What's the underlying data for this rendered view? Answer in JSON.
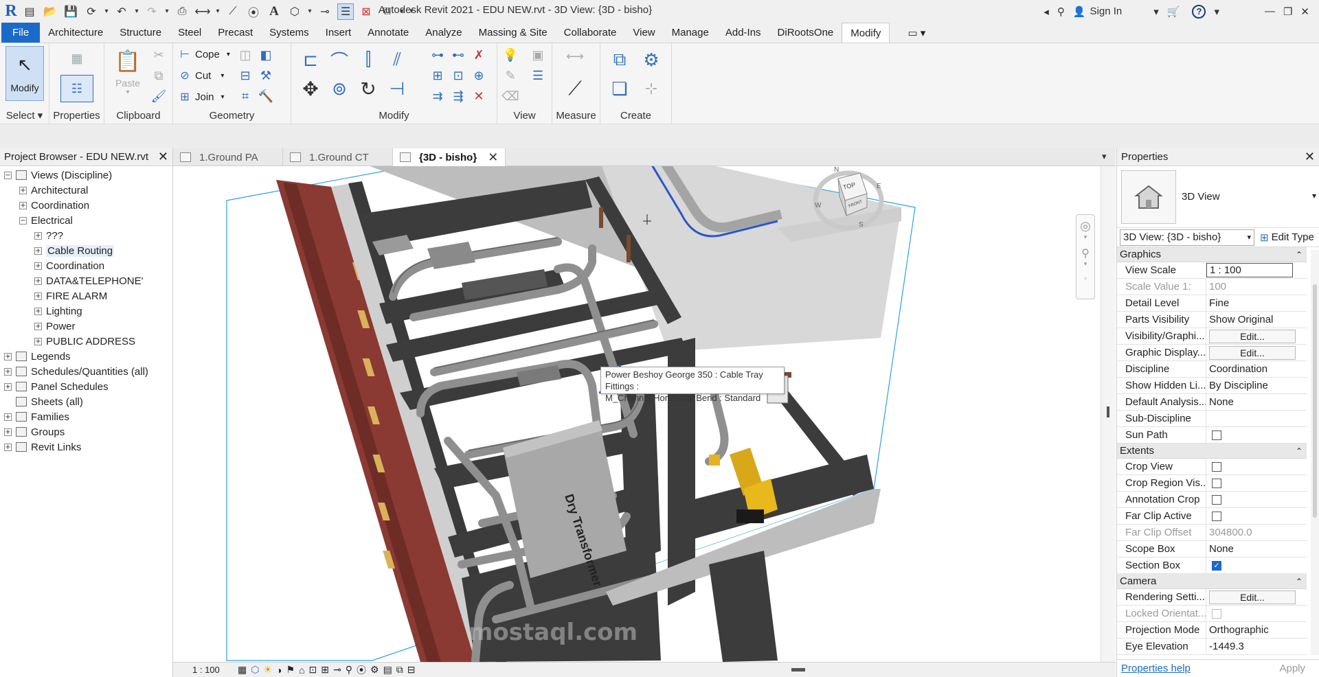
{
  "window": {
    "title": "Autodesk Revit 2021 - EDU NEW.rvt - 3D View: {3D - bisho}",
    "sign_in": "Sign In"
  },
  "menu": {
    "tabs": [
      "File",
      "Architecture",
      "Structure",
      "Steel",
      "Precast",
      "Systems",
      "Insert",
      "Annotate",
      "Analyze",
      "Massing & Site",
      "Collaborate",
      "View",
      "Manage",
      "Add-Ins",
      "DiRootsOne",
      "Modify"
    ],
    "active": "Modify"
  },
  "ribbon": {
    "modify_label": "Modify",
    "select_label": "Select",
    "properties_label": "Properties",
    "paste_label": "Paste",
    "clipboard_label": "Clipboard",
    "cope_label": "Cope",
    "cut_label": "Cut",
    "join_label": "Join",
    "geometry_label": "Geometry",
    "modify_panel_label": "Modify",
    "view_label": "View",
    "measure_label": "Measure",
    "create_label": "Create"
  },
  "browser": {
    "title": "Project Browser - EDU NEW.rvt",
    "items": [
      {
        "label": "Views (Discipline)",
        "level": 0,
        "toggle": "−",
        "icon": true
      },
      {
        "label": "Architectural",
        "level": 1,
        "toggle": "+"
      },
      {
        "label": "Coordination",
        "level": 1,
        "toggle": "+"
      },
      {
        "label": "Electrical",
        "level": 1,
        "toggle": "−"
      },
      {
        "label": "???",
        "level": 2,
        "toggle": "+"
      },
      {
        "label": "Cable Routing",
        "level": 2,
        "toggle": "+",
        "selected": true
      },
      {
        "label": "Coordination",
        "level": 2,
        "toggle": "+"
      },
      {
        "label": "DATA&TELEPHONE'",
        "level": 2,
        "toggle": "+"
      },
      {
        "label": "FIRE ALARM",
        "level": 2,
        "toggle": "+"
      },
      {
        "label": "Lighting",
        "level": 2,
        "toggle": "+"
      },
      {
        "label": "Power",
        "level": 2,
        "toggle": "+"
      },
      {
        "label": "PUBLIC ADDRESS",
        "level": 2,
        "toggle": "+"
      },
      {
        "label": "Legends",
        "level": 0,
        "toggle": "+",
        "icon": true
      },
      {
        "label": "Schedules/Quantities (all)",
        "level": 0,
        "toggle": "+",
        "icon": true
      },
      {
        "label": "Panel Schedules",
        "level": 0,
        "toggle": "+",
        "icon": true
      },
      {
        "label": "Sheets (all)",
        "level": 0,
        "toggle": "",
        "icon": true
      },
      {
        "label": "Families",
        "level": 0,
        "toggle": "+",
        "icon": true
      },
      {
        "label": "Groups",
        "level": 0,
        "toggle": "+",
        "icon": true
      },
      {
        "label": "Revit Links",
        "level": 0,
        "toggle": "+",
        "icon": true
      }
    ]
  },
  "view_tabs": [
    {
      "label": "1.Ground PA",
      "active": false
    },
    {
      "label": "1.Ground CT",
      "active": false
    },
    {
      "label": "{3D - bisho}",
      "active": true
    }
  ],
  "viewport": {
    "tooltip_line1": "Power Beshoy George 350 : Cable Tray Fittings :",
    "tooltip_line2": "M_Channel Horizontal Bend : Standard",
    "transformer_label": "Dry Transformer",
    "viewcube_top": "TOP",
    "viewcube_front": "FRONT",
    "compass": [
      "N",
      "E",
      "S",
      "W"
    ],
    "watermark": "mostaql.com"
  },
  "view_bar": {
    "scale": "1 : 100"
  },
  "properties": {
    "title": "Properties",
    "type_name": "3D View",
    "instance": "3D View: {3D - bisho}",
    "edit_type": "Edit Type",
    "groups": [
      {
        "name": "Graphics",
        "rows": [
          {
            "name": "View Scale",
            "value": "1 : 100",
            "kind": "boxed"
          },
          {
            "name": "Scale Value    1:",
            "value": "100",
            "kind": "dim"
          },
          {
            "name": "Detail Level",
            "value": "Fine"
          },
          {
            "name": "Parts Visibility",
            "value": "Show Original"
          },
          {
            "name": "Visibility/Graphi...",
            "value": "Edit...",
            "kind": "button"
          },
          {
            "name": "Graphic Display...",
            "value": "Edit...",
            "kind": "button"
          },
          {
            "name": "Discipline",
            "value": "Coordination"
          },
          {
            "name": "Show Hidden Li...",
            "value": "By Discipline"
          },
          {
            "name": "Default Analysis...",
            "value": "None"
          },
          {
            "name": "Sub-Discipline",
            "value": ""
          },
          {
            "name": "Sun Path",
            "value": "",
            "kind": "check"
          }
        ]
      },
      {
        "name": "Extents",
        "rows": [
          {
            "name": "Crop View",
            "value": "",
            "kind": "check"
          },
          {
            "name": "Crop Region Vis...",
            "value": "",
            "kind": "check"
          },
          {
            "name": "Annotation Crop",
            "value": "",
            "kind": "check"
          },
          {
            "name": "Far Clip Active",
            "value": "",
            "kind": "check"
          },
          {
            "name": "Far Clip Offset",
            "value": "304800.0",
            "kind": "dim"
          },
          {
            "name": "Scope Box",
            "value": "None"
          },
          {
            "name": "Section Box",
            "value": "",
            "kind": "checked"
          }
        ]
      },
      {
        "name": "Camera",
        "rows": [
          {
            "name": "Rendering Setti...",
            "value": "Edit...",
            "kind": "button"
          },
          {
            "name": "Locked Orientat...",
            "value": "",
            "kind": "checkdim"
          },
          {
            "name": "Projection Mode",
            "value": "Orthographic"
          },
          {
            "name": "Eye Elevation",
            "value": "-1449.3"
          }
        ]
      }
    ],
    "help": "Properties help",
    "apply": "Apply"
  },
  "colors": {
    "accent": "#1b6ac9",
    "brick": "#8a3a32",
    "wall": "#3c3c3c",
    "tray": "#8f8f8f",
    "section_box": "#29a3e0"
  }
}
